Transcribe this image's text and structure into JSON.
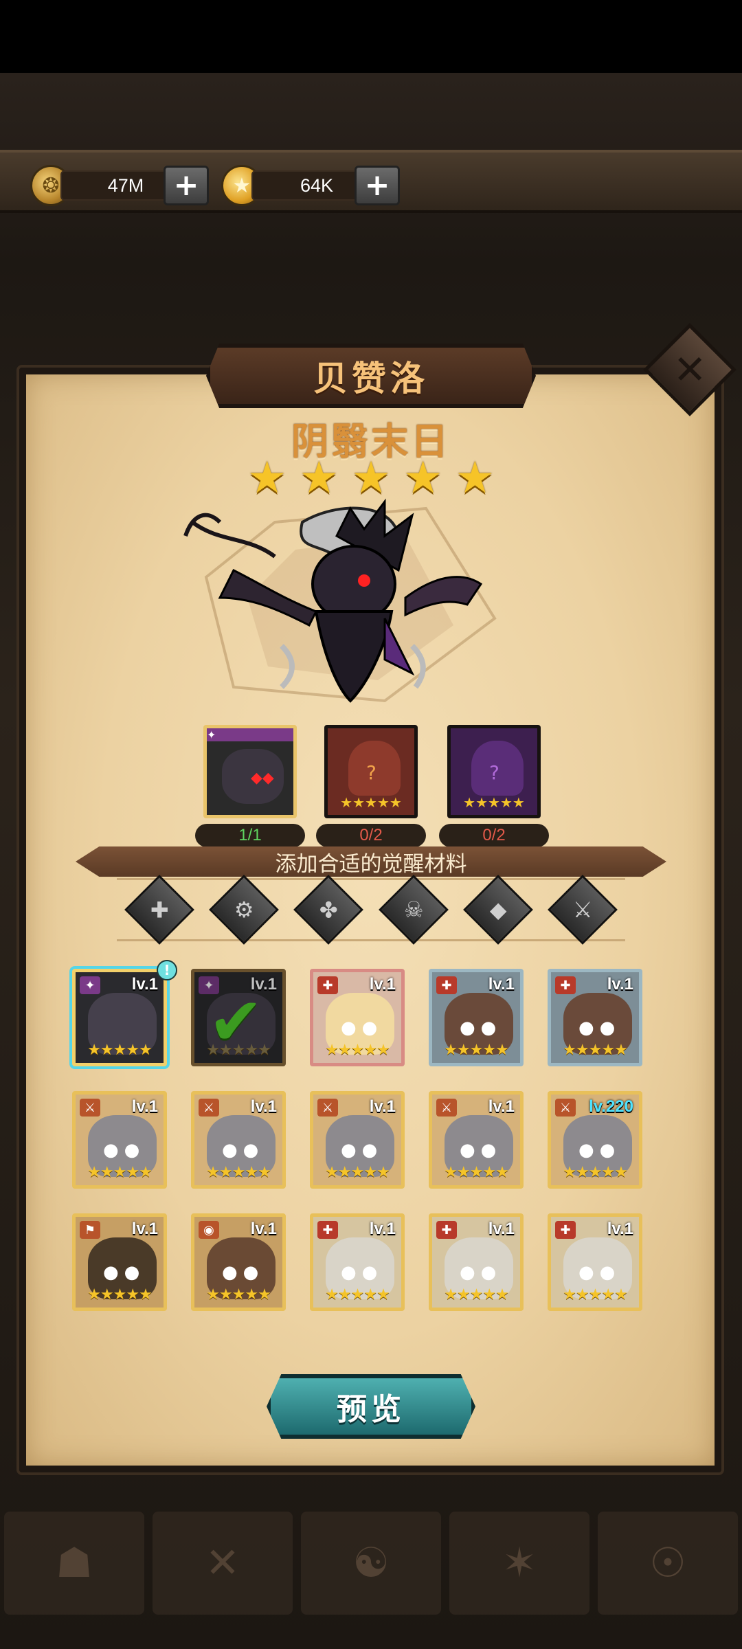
{
  "resources": {
    "gold": {
      "value": "47M",
      "icon": "gold-coin-icon"
    },
    "gems": {
      "value": "64K",
      "icon": "star-coin-icon"
    }
  },
  "hero": {
    "name": "贝赞洛",
    "awaken_title": "阴翳末日",
    "stars": 5
  },
  "required": [
    {
      "count": "1/1",
      "count_color": "#5fd45f",
      "stars": "",
      "color": "#2a2a2a"
    },
    {
      "count": "0/2",
      "count_color": "#e35a4a",
      "stars": "★★★★★",
      "color": "#6b2b22"
    },
    {
      "count": "0/2",
      "count_color": "#e35a4a",
      "stars": "★★★★★",
      "color": "#3d1f4f"
    }
  ],
  "hint": "添加合适的觉醒材料",
  "filters": [
    "all",
    "warrior",
    "tank",
    "assassin",
    "mage",
    "support"
  ],
  "materials": [
    {
      "lv": "lv.1",
      "stars": "★★★★★",
      "theme": "dark",
      "frame": "#f2d06a",
      "selected": true,
      "badge": "!"
    },
    {
      "lv": "lv.1",
      "stars": "★★★★★",
      "theme": "dark",
      "frame": "#8a6a3a",
      "checked": true
    },
    {
      "lv": "lv.1",
      "stars": "★★★★★",
      "theme": "blonde",
      "frame": "#d88b84"
    },
    {
      "lv": "lv.1",
      "stars": "★★★★★",
      "theme": "goggle",
      "frame": "#9cb7c2"
    },
    {
      "lv": "lv.1",
      "stars": "★★★★★",
      "theme": "goggle",
      "frame": "#9cb7c2"
    },
    {
      "lv": "lv.1",
      "stars": "★★★★★",
      "theme": "knight",
      "frame": "#e8c05a"
    },
    {
      "lv": "lv.1",
      "stars": "★★★★★",
      "theme": "knight",
      "frame": "#e8c05a"
    },
    {
      "lv": "lv.1",
      "stars": "★★★★★",
      "theme": "knight",
      "frame": "#e8c05a"
    },
    {
      "lv": "lv.1",
      "stars": "★★★★★",
      "theme": "knight",
      "frame": "#e8c05a"
    },
    {
      "lv": "lv.220",
      "stars": "★★★★★",
      "theme": "knight",
      "frame": "#e8c05a",
      "hi": true
    },
    {
      "lv": "lv.1",
      "stars": "★★★★★",
      "theme": "hat",
      "frame": "#e8c05a"
    },
    {
      "lv": "lv.1",
      "stars": "★★★★★",
      "theme": "glasses",
      "frame": "#e8c05a"
    },
    {
      "lv": "lv.1",
      "stars": "★★★★★",
      "theme": "robot",
      "frame": "#e8c05a"
    },
    {
      "lv": "lv.1",
      "stars": "★★★★★",
      "theme": "robot",
      "frame": "#e8c05a"
    },
    {
      "lv": "lv.1",
      "stars": "★★★★★",
      "theme": "robot",
      "frame": "#e8c05a"
    }
  ],
  "preview_label": "预览",
  "close_icon": "close-x-icon"
}
